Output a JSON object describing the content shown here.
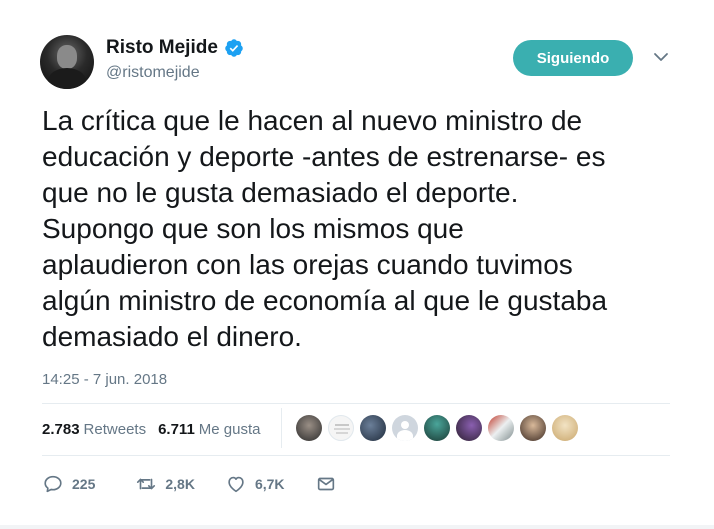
{
  "author": {
    "name": "Risto Mejide",
    "handle": "@ristomejide",
    "verified": true
  },
  "follow_button": {
    "label": "Siguiendo",
    "color": "#3aafb0"
  },
  "tweet": {
    "lines": [
      "La crítica que le hacen al nuevo ministro de",
      "educación y deporte -antes de estrenarse- es",
      "que no le gusta demasiado el deporte.",
      "Supongo que son los mismos que",
      "aplaudieron con las orejas cuando tuvimos",
      "algún ministro de economía al que le gustaba",
      "demasiado el dinero."
    ],
    "timestamp": "14:25 - 7 jun. 2018"
  },
  "stats": {
    "retweets_count": "2.783",
    "retweets_label": "Retweets",
    "likes_count": "6.711",
    "likes_label": "Me gusta"
  },
  "actions": {
    "reply_count": "225",
    "retweet_count": "2,8K",
    "like_count": "6,7K"
  },
  "icons": [
    "verified-badge-icon",
    "chevron-down-icon",
    "reply-icon",
    "retweet-icon",
    "like-icon",
    "direct-message-icon"
  ],
  "colors": {
    "text": "#14171a",
    "secondary": "#657786",
    "verified": "#1da1f2",
    "divider": "#e6ecf0"
  }
}
